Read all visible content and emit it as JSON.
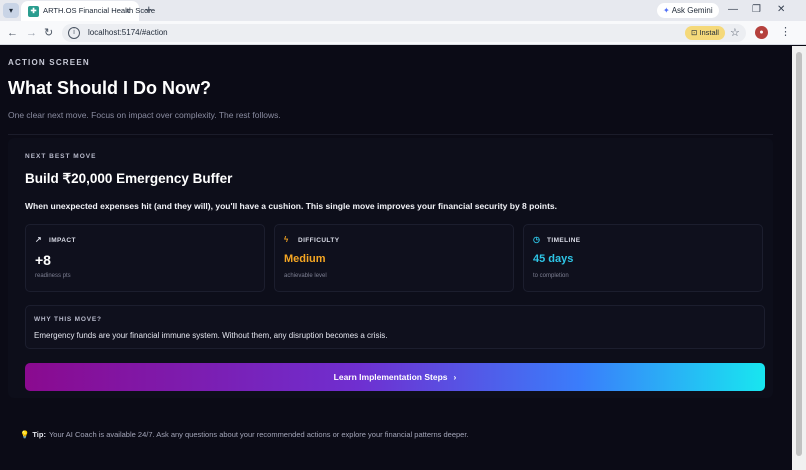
{
  "browser": {
    "tab_title": "ARTH.OS Financial Health Score",
    "tab_close": "×",
    "new_tab": "+",
    "ask_gemini": "Ask Gemini",
    "url": "localhost:5174/#action",
    "install_label": "Install",
    "menu_icon": "chevron-down-icon",
    "back_icon": "arrow-left-icon",
    "forward_icon": "arrow-right-icon",
    "reload_icon": "reload-icon"
  },
  "page": {
    "eyebrow": "ACTION SCREEN",
    "title": "What Should I Do Now?",
    "subtitle": "One clear next move. Focus on impact over complexity. The rest follows."
  },
  "next_move": {
    "label": "NEXT BEST MOVE",
    "title": "Build ₹20,000 Emergency Buffer",
    "description": "When unexpected expenses hit (and they will), you'll have a cushion. This single move improves your financial security by 8 points."
  },
  "metrics": [
    {
      "label": "IMPACT",
      "value": "+8",
      "sub": "readiness pts",
      "icon": "trend-up-icon",
      "color": "#ffffff"
    },
    {
      "label": "DIFFICULTY",
      "value": "Medium",
      "sub": "achievable level",
      "icon": "lightning-icon",
      "color": "#f5a623"
    },
    {
      "label": "TIMELINE",
      "value": "45 days",
      "sub": "to completion",
      "icon": "clock-icon",
      "color": "#2ec5e6"
    }
  ],
  "why": {
    "label": "WHY THIS MOVE?",
    "text": "Emergency funds are your financial immune system. Without them, any disruption becomes a crisis."
  },
  "cta": {
    "label": "Learn Implementation Steps",
    "chevron": "›"
  },
  "tip": {
    "label": "Tip:",
    "text": "Your AI Coach is available 24/7. Ask any questions about your recommended actions or explore your financial patterns deeper."
  },
  "colors": {
    "background": "#0b0b16",
    "gradient_start": "#8a0a8f",
    "gradient_end": "#18e6f0",
    "difficulty": "#f5a623",
    "timeline": "#2ec5e6"
  }
}
